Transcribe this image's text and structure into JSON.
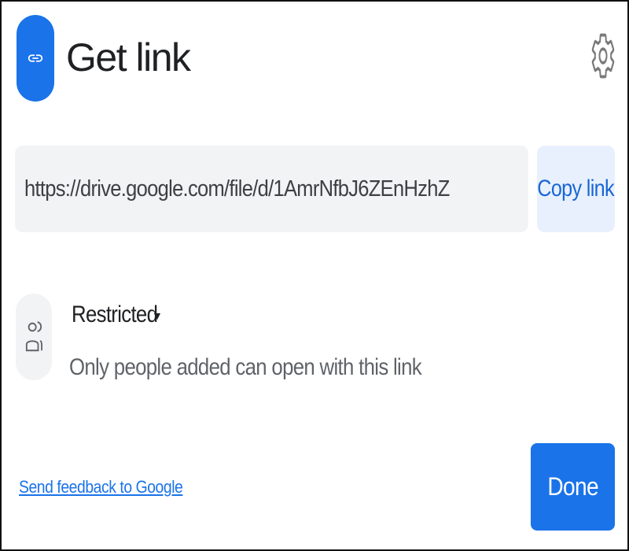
{
  "dialog": {
    "title": "Get link",
    "title_icon": "link-icon",
    "settings_icon": "gear-icon",
    "accent_color": "#1a73e8"
  },
  "link": {
    "url": "https://drive.google.com/file/d/1AmrNfbJ6ZEnHzhZ",
    "copy_label": "Copy link"
  },
  "access": {
    "icon": "people-icon",
    "level": "Restricted",
    "description": "Only people added can open with this link"
  },
  "footer": {
    "feedback_label": "Send feedback to Google",
    "done_label": "Done"
  }
}
